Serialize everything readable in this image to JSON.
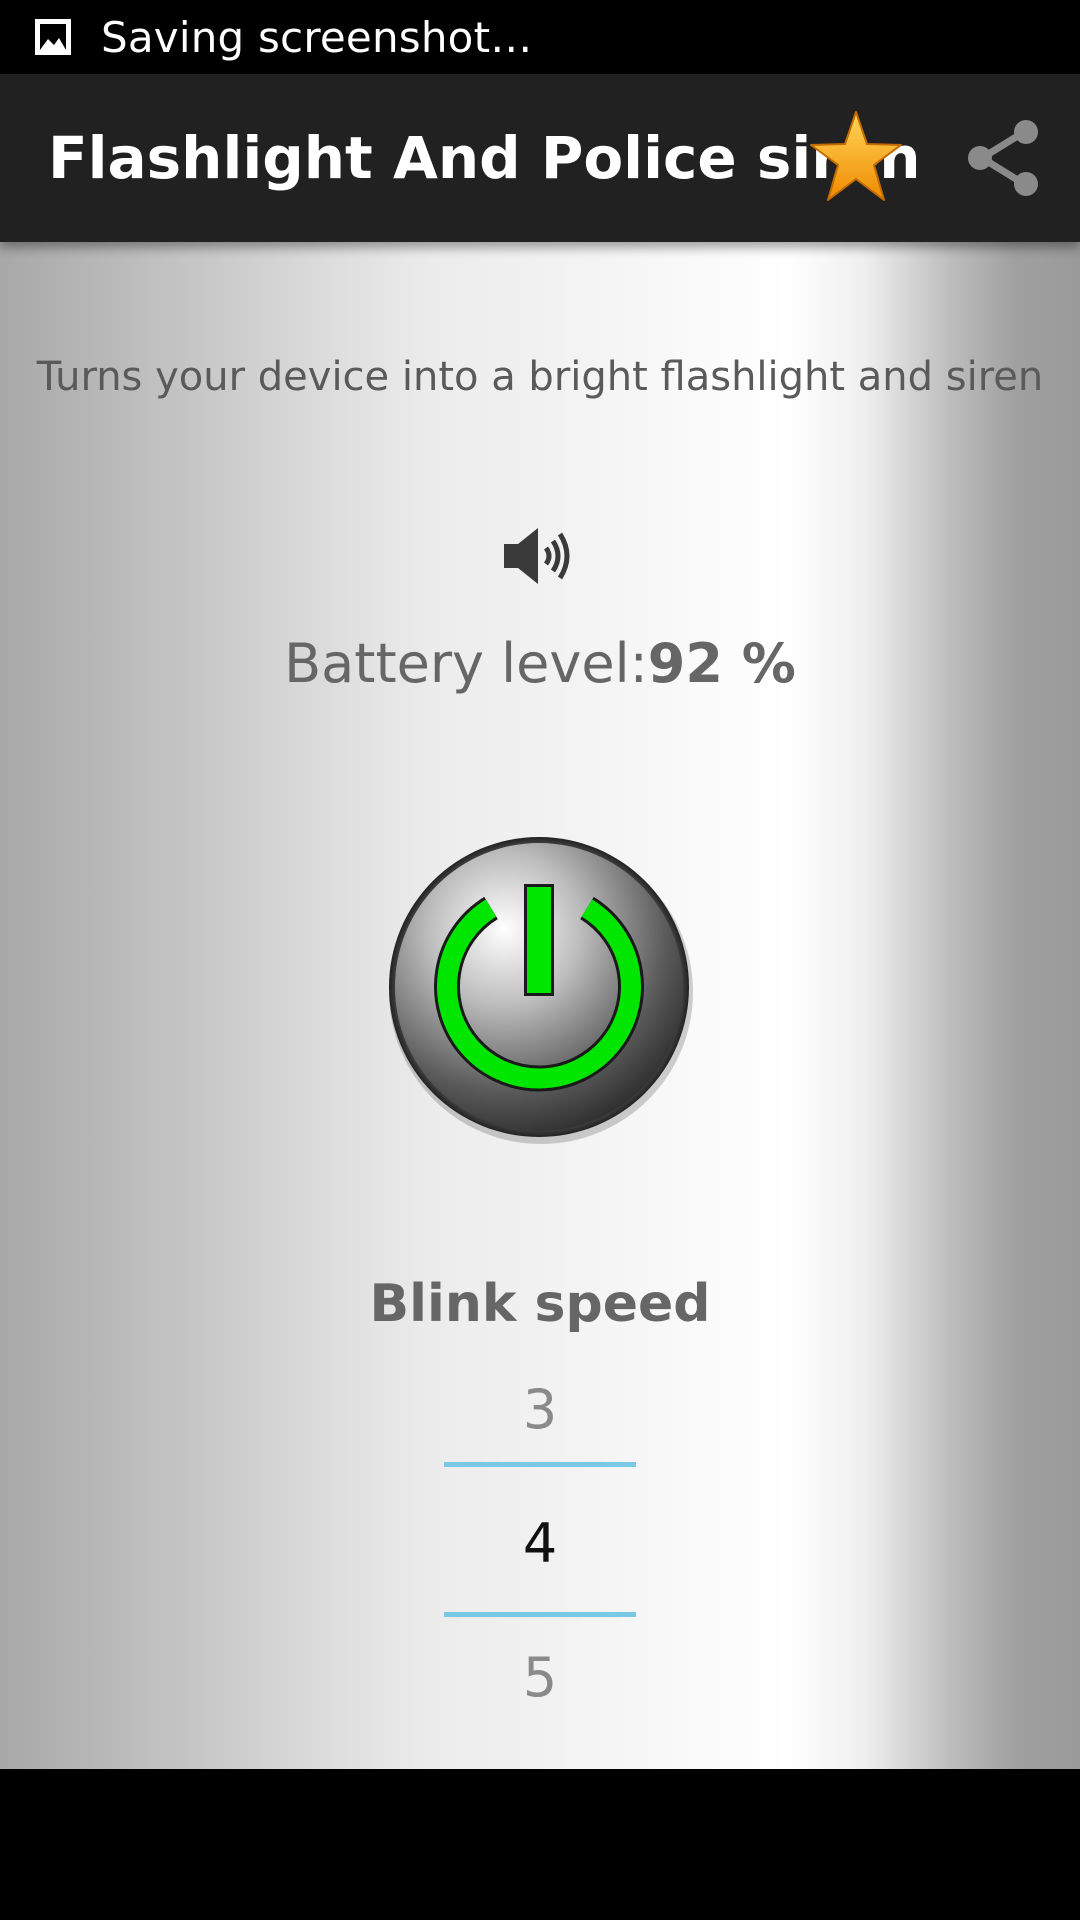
{
  "status_bar": {
    "text": "Saving screenshot…",
    "icon": "image-icon"
  },
  "app_bar": {
    "title": "Flashlight And Police siren",
    "actions": [
      {
        "icon": "star-icon",
        "color": "#f4b21f"
      },
      {
        "icon": "share-icon",
        "color": "#8a8a8a"
      }
    ]
  },
  "main": {
    "subtitle": "Turns your device into a bright flashlight and siren",
    "sound_icon": "speaker-icon",
    "battery_label": "Battery level:",
    "battery_value": "92 %",
    "power_icon": "power-icon",
    "power_color": "#00e600",
    "blink_label": "Blink speed",
    "picker": {
      "prev": "3",
      "current": "4",
      "next": "5",
      "divider_color": "#79c9e4"
    }
  }
}
